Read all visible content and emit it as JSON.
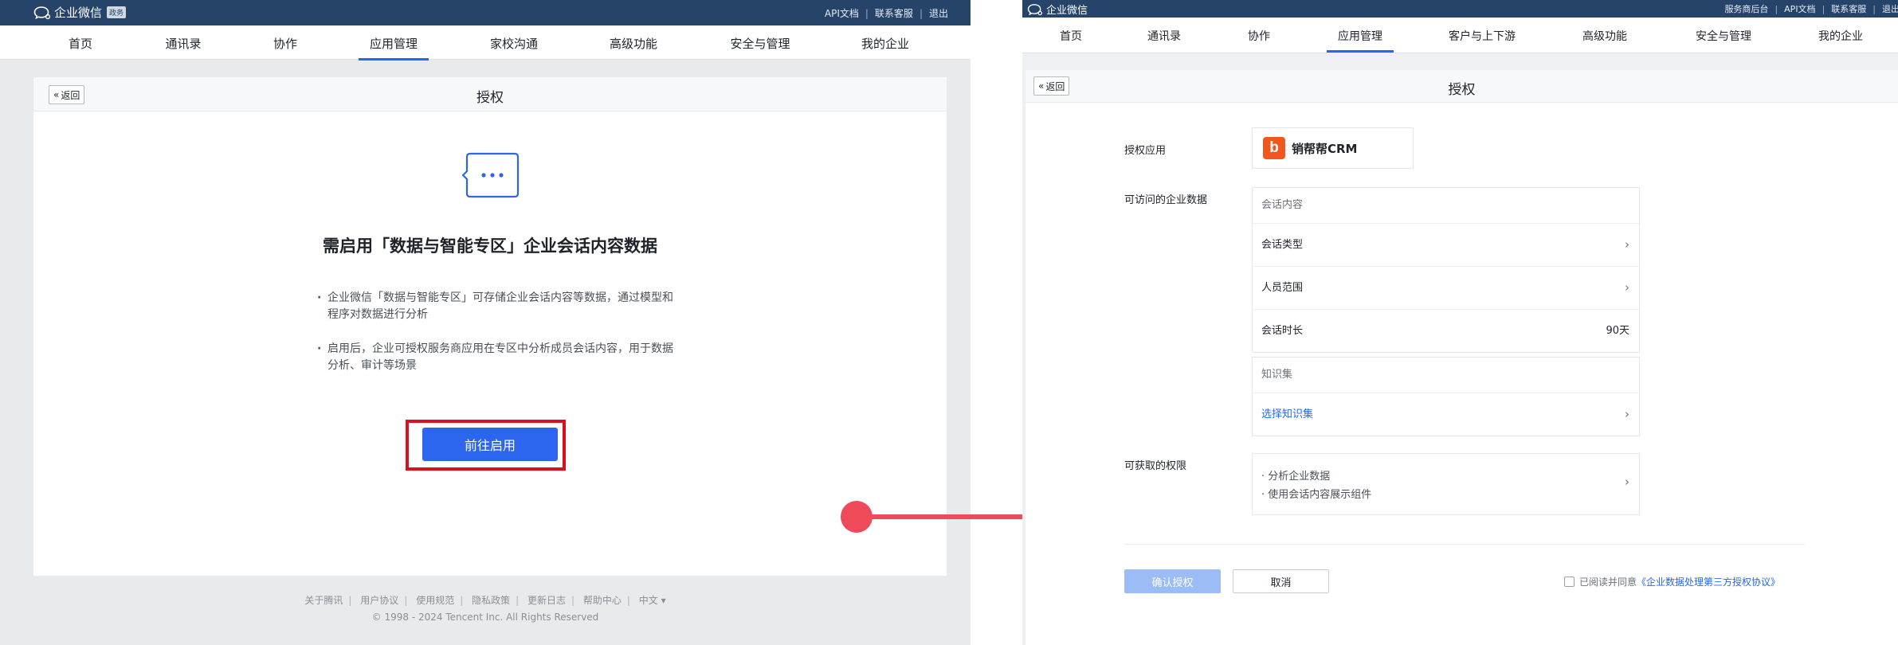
{
  "colors": {
    "topbar": "#26436a",
    "primary": "#2c66ee",
    "primary_disabled": "#9cbcf7",
    "highlight": "#d8101f",
    "arrow": "#ee4a5a",
    "logo": "#f1561f",
    "link": "#2468f2"
  },
  "left": {
    "brand": {
      "icon": "wechat-work-logo-icon",
      "name": "企业微信",
      "badge": "政务"
    },
    "top_links": [
      "API文档",
      "联系客服",
      "退出"
    ],
    "nav": {
      "items": [
        "首页",
        "通讯录",
        "协作",
        "应用管理",
        "家校沟通",
        "高级功能",
        "安全与管理",
        "我的企业"
      ],
      "active": "应用管理"
    },
    "card": {
      "back_label": "返回",
      "title": "授权",
      "icon": "chat-bubble-icon",
      "heading": "需启用「数据与智能专区」企业会话内容数据",
      "bullets": [
        "企业微信「数据与智能专区」可存储企业会话内容等数据，通过模型和程序对数据进行分析",
        "启用后，企业可授权服务商应用在专区中分析成员会话内容，用于数据分析、审计等场景"
      ],
      "button": "前往启用"
    },
    "footer": {
      "links": [
        "关于腾讯",
        "用户协议",
        "使用规范",
        "隐私政策",
        "更新日志",
        "帮助中心",
        "中文 ▾"
      ],
      "copyright": "© 1998 - 2024 Tencent Inc. All Rights Reserved"
    }
  },
  "right": {
    "brand": {
      "icon": "wechat-work-logo-icon",
      "name": "企业微信"
    },
    "top_links": [
      "服务商后台",
      "API文档",
      "联系客服",
      "退出"
    ],
    "nav": {
      "items": [
        "首页",
        "通讯录",
        "协作",
        "应用管理",
        "客户与上下游",
        "高级功能",
        "安全与管理",
        "我的企业"
      ],
      "active": "应用管理"
    },
    "card": {
      "back_label": "返回",
      "title": "授权",
      "app_label": "授权应用",
      "app": {
        "logo_letter": "b",
        "name": "销帮帮CRM"
      },
      "data_label": "可访问的企业数据",
      "session_box": {
        "header": "会话内容",
        "rows": [
          {
            "label": "会话类型",
            "value": ""
          },
          {
            "label": "人员范围",
            "value": ""
          },
          {
            "label": "会话时长",
            "value": "90天"
          }
        ]
      },
      "knowledge_box": {
        "header": "知识集",
        "link": "选择知识集"
      },
      "perm_label": "可获取的权限",
      "permissions": [
        "· 分析企业数据",
        "· 使用会话内容展示组件"
      ],
      "confirm": "确认授权",
      "cancel": "取消",
      "agree_text": "已阅读并同意",
      "agree_link": "《企业数据处理第三方授权协议》"
    }
  }
}
